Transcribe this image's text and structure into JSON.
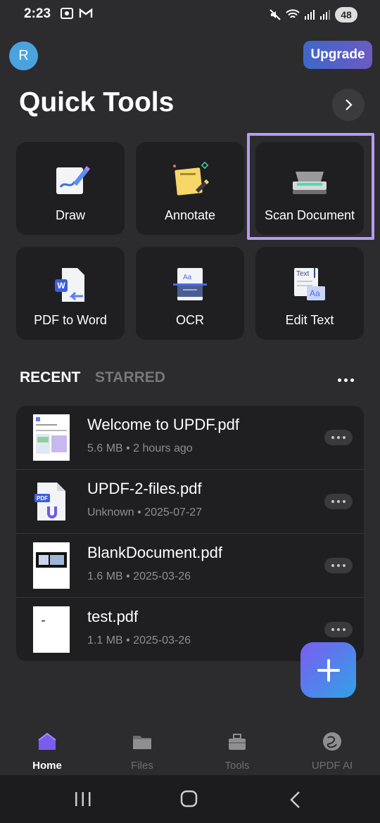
{
  "status": {
    "time": "2:23",
    "battery": "48"
  },
  "header": {
    "avatar_letter": "R",
    "upgrade_label": "Upgrade",
    "title": "Quick Tools"
  },
  "tools": [
    {
      "label": "Draw"
    },
    {
      "label": "Annotate"
    },
    {
      "label": "Scan Document"
    },
    {
      "label": "PDF to Word"
    },
    {
      "label": "OCR"
    },
    {
      "label": "Edit Text"
    }
  ],
  "tabs": {
    "recent": "RECENT",
    "starred": "STARRED"
  },
  "files": [
    {
      "name": "Welcome to UPDF.pdf",
      "meta": "5.6 MB • 2 hours ago"
    },
    {
      "name": "UPDF-2-files.pdf",
      "meta": "Unknown • 2025-07-27"
    },
    {
      "name": "BlankDocument.pdf",
      "meta": "1.6 MB • 2025-03-26"
    },
    {
      "name": "test.pdf",
      "meta": "1.1 MB • 2025-03-26"
    }
  ],
  "nav": [
    {
      "label": "Home"
    },
    {
      "label": "Files"
    },
    {
      "label": "Tools"
    },
    {
      "label": "UPDF AI"
    }
  ],
  "colors": {
    "accent": "#b59cf0",
    "background": "#2c2c2e",
    "card": "#1f1f21"
  }
}
